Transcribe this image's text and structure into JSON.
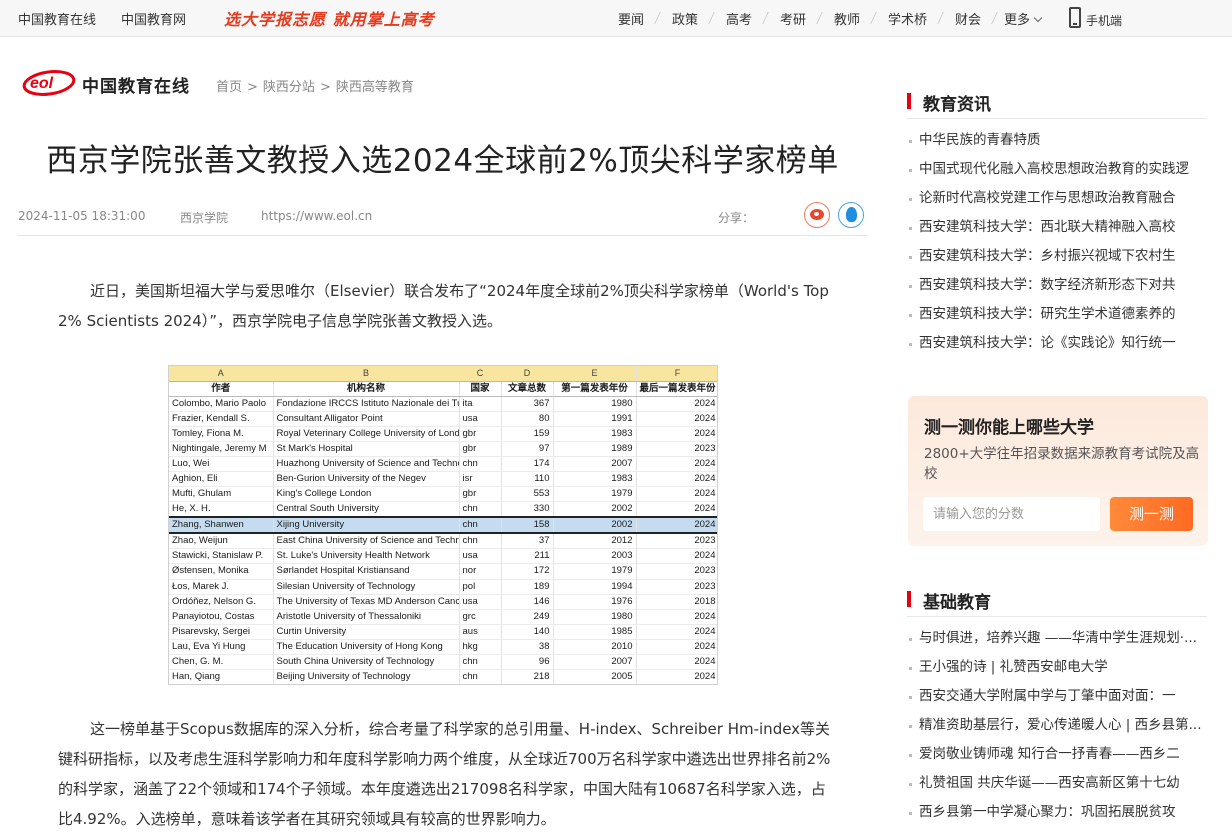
{
  "topbar": {
    "site_links": [
      "中国教育在线",
      "中国教育网"
    ],
    "slogan": "选大学报志愿 就用掌上高考",
    "nav": [
      "要闻",
      "政策",
      "高考",
      "考研",
      "教师",
      "学术桥",
      "财会"
    ],
    "more": "更多",
    "mobile": "手机端"
  },
  "logo": {
    "mark_text": "eol",
    "name": "中国教育在线"
  },
  "breadcrumb": [
    "首页",
    "陕西分站",
    "陕西高等教育"
  ],
  "article": {
    "title": "西京学院张善文教授入选2024全球前2%顶尖科学家榜单",
    "date": "2024-11-05 18:31:00",
    "source": "西京学院",
    "url": "https://www.eol.cn",
    "share_label": "分享：",
    "para1": "近日，美国斯坦福大学与爱思唯尔（Elsevier）联合发布了“2024年度全球前2%顶尖科学家榜单（World's Top 2% Scientists 2024）”，西京学院电子信息学院张善文教授入选。",
    "para2": "这一榜单基于Scopus数据库的深入分析，综合考量了科学家的总引用量、H-index、Schreiber Hm-index等关键科研指标，以及考虑生涯科学影响力和年度科学影响力两个维度，从全球近700万名科学家中遴选出世界排名前2%的科学家，涵盖了22个领域和174个子领域。本年度遴选出217098名科学家，中国大陆有10687名科学家入选，占比4.92%。入选榜单，意味着该学者在其研究领域具有较高的世界影响力。"
  },
  "sheet": {
    "col_letters": [
      "A",
      "B",
      "C",
      "D",
      "E",
      "F"
    ],
    "headers": [
      "作者",
      "机构名称",
      "国家",
      "文章总数",
      "第一篇发表年份",
      "最后一篇发表年份"
    ],
    "rows": [
      [
        "Colombo, Mario Paolo",
        "Fondazione IRCCS Istituto Nazionale dei Tumori",
        "ita",
        "367",
        "1980",
        "2024"
      ],
      [
        "Frazier, Kendall S.",
        "Consultant Alligator Point",
        "usa",
        "80",
        "1991",
        "2024"
      ],
      [
        "Tomley, Fiona M.",
        "Royal Veterinary College University of London",
        "gbr",
        "159",
        "1983",
        "2024"
      ],
      [
        "Nightingale, Jeremy M",
        "St Mark's Hospital",
        "gbr",
        "97",
        "1989",
        "2023"
      ],
      [
        "Luo, Wei",
        "Huazhong University of Science and Technology",
        "chn",
        "174",
        "2007",
        "2024"
      ],
      [
        "Aghion, Eli",
        "Ben-Gurion University of the Negev",
        "isr",
        "110",
        "1983",
        "2024"
      ],
      [
        "Mufti, Ghulam",
        "King's College London",
        "gbr",
        "553",
        "1979",
        "2024"
      ],
      [
        "He, X. H.",
        "Central South University",
        "chn",
        "330",
        "2002",
        "2024"
      ],
      [
        "Zhang, Shanwen",
        "Xijing University",
        "chn",
        "158",
        "2002",
        "2024"
      ],
      [
        "Zhao, Weijun",
        "East China University of Science and Technology",
        "chn",
        "37",
        "2012",
        "2023"
      ],
      [
        "Stawicki, Stanislaw P.",
        "St. Luke's University Health Network",
        "usa",
        "211",
        "2003",
        "2024"
      ],
      [
        "Østensen, Monika",
        "Sørlandet Hospital Kristiansand",
        "nor",
        "172",
        "1979",
        "2023"
      ],
      [
        "Łos, Marek J.",
        "Silesian University of Technology",
        "pol",
        "189",
        "1994",
        "2023"
      ],
      [
        "Ordóñez, Nelson G.",
        "The University of Texas MD Anderson Cancer Center",
        "usa",
        "146",
        "1976",
        "2018"
      ],
      [
        "Panayiotou, Costas",
        "Aristotle University of Thessaloniki",
        "grc",
        "249",
        "1980",
        "2024"
      ],
      [
        "Pisarevsky, Sergei",
        "Curtin University",
        "aus",
        "140",
        "1985",
        "2024"
      ],
      [
        "Lau, Eva Yi Hung",
        "The Education University of Hong Kong",
        "hkg",
        "38",
        "2010",
        "2024"
      ],
      [
        "Chen, G. M.",
        "South China University of Technology",
        "chn",
        "96",
        "2007",
        "2024"
      ],
      [
        "Han, Qiang",
        "Beijing University of Technology",
        "chn",
        "218",
        "2005",
        "2024"
      ]
    ],
    "selected_row": 8
  },
  "sidebar": {
    "news_heading": "教育资讯",
    "news": [
      "中华民族的青春特质",
      "中国式现代化融入高校思想政治教育的实践逻",
      "论新时代高校党建工作与思想政治教育融合",
      "西安建筑科技大学：西北联大精神融入高校",
      "西安建筑科技大学：乡村振兴视域下农村生",
      "西安建筑科技大学：数字经济新形态下对共",
      "西安建筑科技大学：研究生学术道德素养的",
      "西安建筑科技大学：论《实践论》知行统一"
    ],
    "quiz": {
      "title": "测一测你能上哪些大学",
      "desc": "2800+大学往年招录数据来源教育考试院及高校",
      "placeholder": "请输入您的分数",
      "button": "测一测"
    },
    "basic_heading": "基础教育",
    "basic": [
      "与时俱进，培养兴趣 ——华清中学生涯规划·...",
      "王小强的诗 | 礼赞西安邮电大学",
      "西安交通大学附属中学与丁肇中面对面：一",
      "精准资助基层行，爱心传递暖人心 | 西乡县第...",
      "爱岗敬业铸师魂 知行合一抒青春——西乡二",
      "礼赞祖国 共庆华诞——西安高新区第十七幼",
      "西乡县第一中学凝心聚力：巩固拓展脱贫攻"
    ]
  }
}
